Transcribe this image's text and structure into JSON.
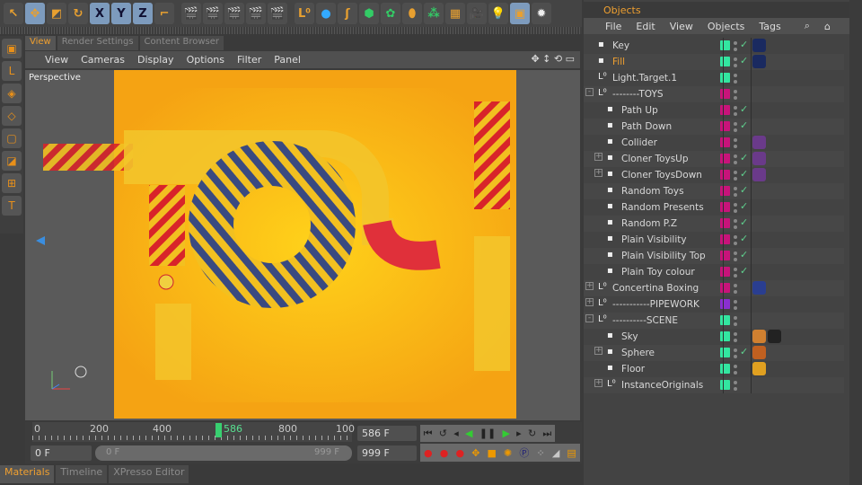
{
  "toolbar": {
    "icons": [
      "select-icon",
      "move-icon",
      "scale-icon",
      "rotate-icon",
      "x-axis-icon",
      "y-axis-icon",
      "z-axis-icon",
      "coordinate-system-icon",
      "render-view-icon",
      "render-active-icon",
      "render-picture-viewer-icon",
      "edit-render-settings-icon",
      "render-settings-icon",
      "null-object-icon",
      "sphere-primitive-icon",
      "spline-pen-icon",
      "nurbs-icon",
      "mograph-cloner-icon",
      "deformer-icon",
      "particle-icon",
      "floor-icon",
      "camera-icon",
      "light-icon",
      "film-icon",
      "gear-icon"
    ],
    "axis_labels": [
      "X",
      "Y",
      "Z"
    ]
  },
  "viewport": {
    "tabs": [
      "View",
      "Render Settings",
      "Content Browser"
    ],
    "menu": [
      "View",
      "Cameras",
      "Display",
      "Options",
      "Filter",
      "Panel"
    ],
    "label": "Perspective"
  },
  "timeline": {
    "ticks": [
      "0",
      "200",
      "400",
      "586",
      "800",
      "100"
    ],
    "current_frame": 586,
    "current_frame_label": "586 F",
    "start": "0 F",
    "range_start": "0 F",
    "range_end": "999 F",
    "end": "999 F"
  },
  "bottom_tabs": [
    "Materials",
    "Timeline",
    "XPresso Editor"
  ],
  "objects": {
    "title": "Objects",
    "menu": [
      "File",
      "Edit",
      "View",
      "Objects",
      "Tags"
    ],
    "colors": {
      "green": "#33e6a0",
      "magenta": "#c8137a",
      "purple": "#8a2fd0"
    },
    "rows": [
      {
        "name": "Key",
        "indent": 0,
        "color": "green",
        "check": true,
        "tags": [
          "target-tag"
        ]
      },
      {
        "name": "Fill",
        "indent": 0,
        "color": "green",
        "check": true,
        "tags": [
          "target-tag"
        ]
      },
      {
        "name": "Light.Target.1",
        "indent": 0,
        "color": "green",
        "check": false,
        "tags": []
      },
      {
        "name": "--------TOYS",
        "indent": 0,
        "color": "magenta",
        "check": false,
        "expand": "-",
        "tags": []
      },
      {
        "name": "Path Up",
        "indent": 1,
        "color": "magenta",
        "check": true,
        "tags": []
      },
      {
        "name": "Path Down",
        "indent": 1,
        "color": "magenta",
        "check": true,
        "tags": []
      },
      {
        "name": "Collider",
        "indent": 1,
        "color": "magenta",
        "check": false,
        "tags": [
          "dynamics-tag"
        ]
      },
      {
        "name": "Cloner ToysUp",
        "indent": 1,
        "color": "magenta",
        "check": true,
        "expand": "+",
        "tags": [
          "dynamics-tag"
        ]
      },
      {
        "name": "Cloner ToysDown",
        "indent": 1,
        "color": "magenta",
        "check": true,
        "expand": "+",
        "tags": [
          "dynamics-tag"
        ]
      },
      {
        "name": "Random Toys",
        "indent": 1,
        "color": "magenta",
        "check": true,
        "tags": []
      },
      {
        "name": "Random Presents",
        "indent": 1,
        "color": "magenta",
        "check": true,
        "tags": []
      },
      {
        "name": "Random P.Z",
        "indent": 1,
        "color": "magenta",
        "check": true,
        "tags": []
      },
      {
        "name": "Plain Visibility",
        "indent": 1,
        "color": "magenta",
        "check": true,
        "tags": []
      },
      {
        "name": "Plain Visibility Top",
        "indent": 1,
        "color": "magenta",
        "check": true,
        "tags": []
      },
      {
        "name": "Plain Toy colour",
        "indent": 1,
        "color": "magenta",
        "check": true,
        "tags": []
      },
      {
        "name": "Concertina Boxing",
        "indent": 0,
        "color": "magenta",
        "check": false,
        "expand": "+",
        "tags": [
          "material-tag-blue"
        ]
      },
      {
        "name": "-----------PIPEWORK",
        "indent": 0,
        "color": "purple",
        "check": false,
        "expand": "+",
        "tags": []
      },
      {
        "name": "----------SCENE",
        "indent": 0,
        "color": "green",
        "check": false,
        "expand": "-",
        "tags": []
      },
      {
        "name": "Sky",
        "indent": 1,
        "color": "green",
        "check": false,
        "tags": [
          "compositing-tag",
          "material-tag-black"
        ]
      },
      {
        "name": "Sphere",
        "indent": 1,
        "color": "green",
        "check": true,
        "expand": "+",
        "tags": [
          "phong-tag"
        ]
      },
      {
        "name": "Floor",
        "indent": 1,
        "color": "green",
        "check": false,
        "tags": [
          "material-tag-yellow"
        ]
      },
      {
        "name": "InstanceOriginals",
        "indent": 1,
        "color": "green",
        "check": false,
        "expand": "+",
        "tags": []
      }
    ]
  }
}
